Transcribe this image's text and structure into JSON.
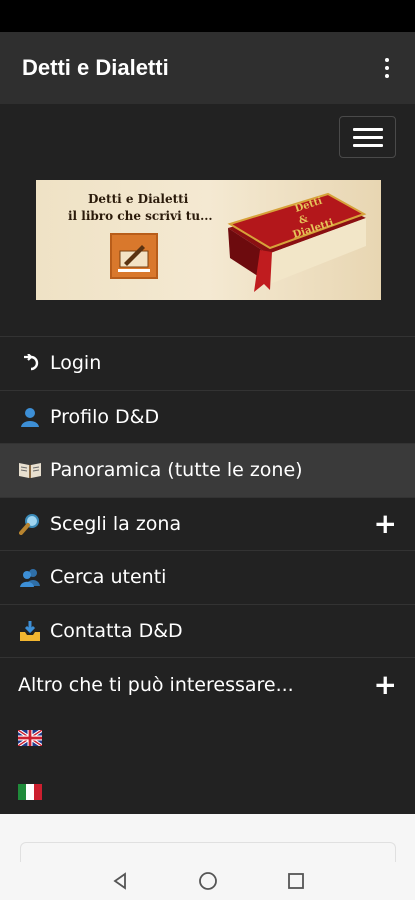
{
  "app_bar": {
    "title": "Detti e Dialetti"
  },
  "banner": {
    "line1": "Detti e Dialetti",
    "line2": "il libro che scrivi tu...",
    "book_text": [
      "Detti",
      "&",
      "Dialetti"
    ]
  },
  "menu": {
    "items": [
      {
        "label": "Login",
        "icon": "login-arrow-icon",
        "active": false
      },
      {
        "label": "Profilo D&D",
        "icon": "user-icon",
        "active": false
      },
      {
        "label": "Panoramica (tutte le zone)",
        "icon": "open-book-icon",
        "active": true
      },
      {
        "label": "Scegli la zona",
        "icon": "magnifier-icon",
        "expandable": true
      },
      {
        "label": "Cerca utenti",
        "icon": "users-icon"
      },
      {
        "label": "Contatta D&D",
        "icon": "inbox-tray-icon"
      },
      {
        "label": "Altro che ti può interessare...",
        "expandable": true
      }
    ],
    "languages": [
      "uk-flag-icon",
      "italy-flag-icon"
    ]
  },
  "colors": {
    "app_bar": "#2f2f2f",
    "nav_bg": "#222222",
    "active_row": "#3a3a3a",
    "book_red": "#b3171b"
  }
}
